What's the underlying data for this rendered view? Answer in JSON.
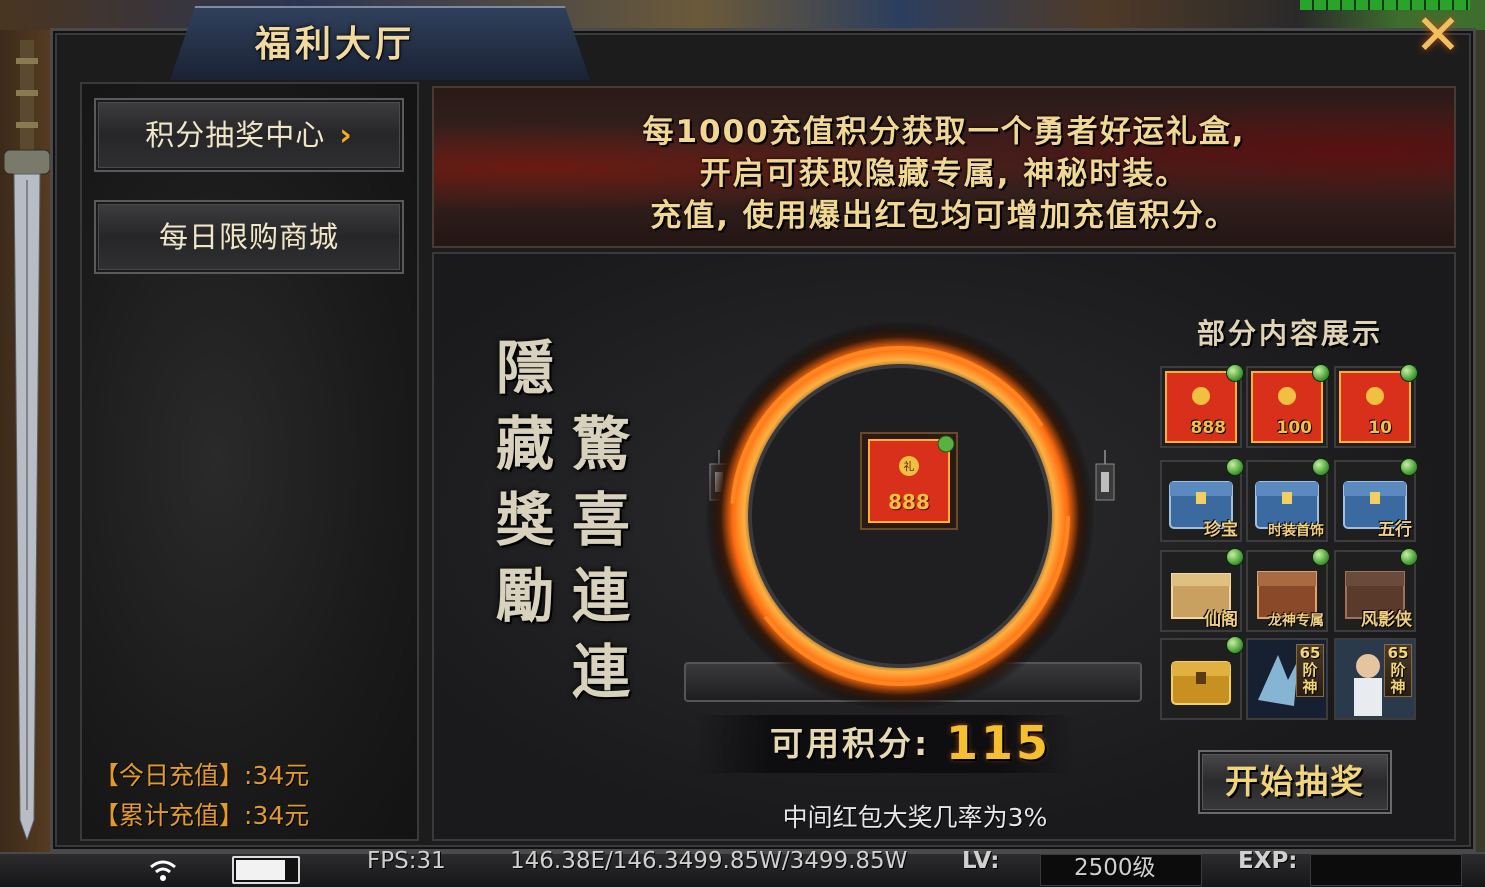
{
  "window": {
    "title": "福利大厅",
    "close_glyph": "✕"
  },
  "sidebar": {
    "items": [
      {
        "label": "积分抽奖中心",
        "chevron": "›",
        "active": true
      },
      {
        "label": "每日限购商城",
        "active": false
      }
    ],
    "today_charge_label": "【今日充值】",
    "today_charge_value": ":34元",
    "total_charge_label": "【累计充值】",
    "total_charge_value": ":34元"
  },
  "banner": {
    "line1": "每1000充值积分获取一个勇者好运礼盒,",
    "line2": "开启可获取隐藏专属, 神秘时装。",
    "line3": "充值, 使用爆出红包均可增加充值积分。"
  },
  "slogan": {
    "column_right": "隱藏獎勵",
    "column_left": "驚喜連連"
  },
  "draw": {
    "main_prize": {
      "label": "888",
      "icon": "red-envelope-icon"
    },
    "points_label": "可用积分:",
    "points_value": "115",
    "odds_text": "中间红包大奖几率为3%",
    "start_button": "开始抽奖"
  },
  "showcase": {
    "title": "部分内容展示",
    "items": [
      {
        "label": "888",
        "icon": "red-envelope-icon"
      },
      {
        "label": "100",
        "icon": "red-envelope-icon"
      },
      {
        "label": "10",
        "icon": "red-envelope-icon"
      },
      {
        "label": "珍宝",
        "icon": "treasure-chest-icon"
      },
      {
        "label": "时装首饰",
        "icon": "treasure-chest-icon"
      },
      {
        "label": "五行",
        "icon": "treasure-chest-icon"
      },
      {
        "label": "仙阁",
        "icon": "gold-box-icon"
      },
      {
        "label": "龙神专属",
        "icon": "wooden-box-icon"
      },
      {
        "label": "风影侠",
        "icon": "dark-box-icon"
      },
      {
        "label": "",
        "icon": "gold-chest-icon"
      },
      {
        "label": "",
        "tag": "65阶神",
        "icon": "ice-wing-icon"
      },
      {
        "label": "",
        "tag": "65阶神",
        "icon": "character-portrait-icon"
      }
    ]
  },
  "statusbar": {
    "fps": "FPS:31",
    "hp_mp": "146.38E/146.3499.85W/3499.85W",
    "lv_label": "LV:",
    "lv_value": "2500级",
    "exp_label": "EXP:",
    "battery_level": 0.85
  },
  "colors": {
    "accent_gold": "#f5c030",
    "charge_orange": "#e39a2a",
    "ring_orange": "#ff7a10",
    "envelope_red": "#d8301a"
  }
}
